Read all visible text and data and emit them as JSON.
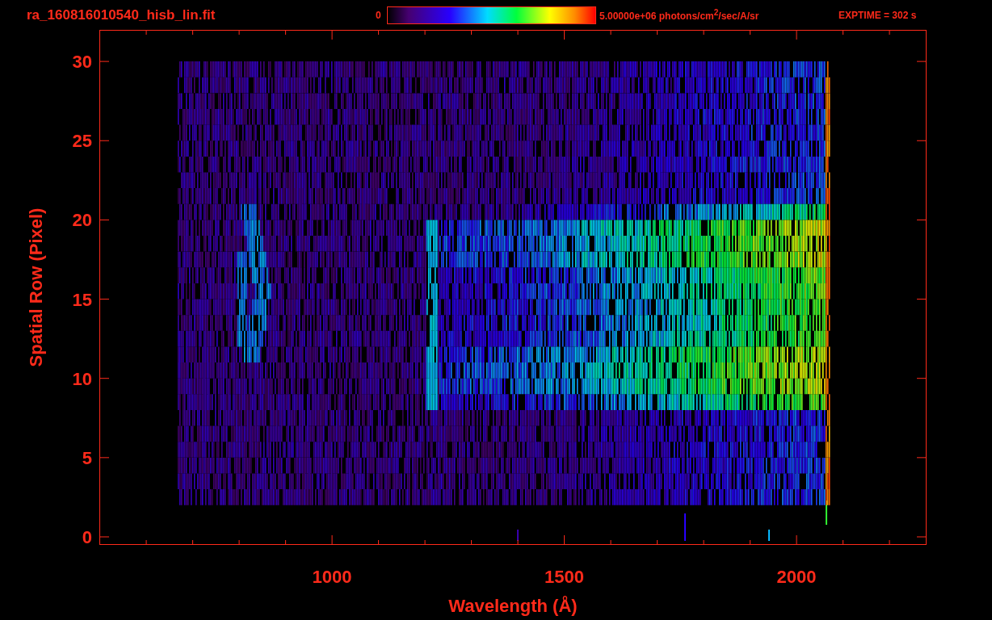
{
  "header": {
    "filename": "ra_160816010540_hisb_lin.fit",
    "colorbar": {
      "min_label": "0",
      "max_label": "5.00000e+06 photons/cm$^{2}$/sec/A/sr"
    },
    "exposure": "EXPTIME = 302 s"
  },
  "plot": {
    "x_axis": {
      "label": "Wavelength (Å)",
      "ticks": [
        "1000",
        "1500",
        "2000"
      ]
    },
    "y_axis": {
      "label": "Spatial Row (Pixel)",
      "ticks": [
        "30",
        "25",
        "20",
        "15",
        "10",
        "5",
        "0"
      ]
    }
  }
}
